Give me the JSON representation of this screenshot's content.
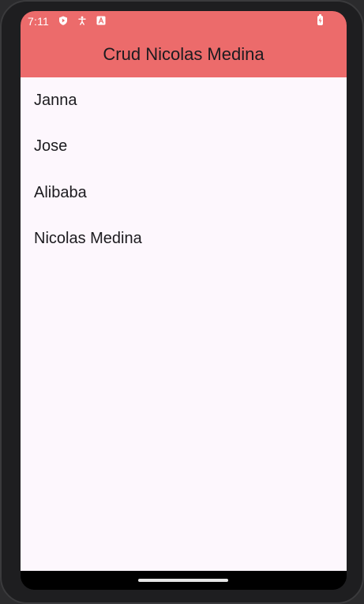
{
  "status_bar": {
    "time": "7:11",
    "icons": [
      "play-protect-icon",
      "accessibility-icon",
      "font-a-icon"
    ],
    "battery_icon": "battery-charging-icon"
  },
  "app_bar": {
    "title": "Crud Nicolas Medina"
  },
  "list": {
    "items": [
      {
        "label": "Janna"
      },
      {
        "label": "Jose"
      },
      {
        "label": "Alibaba"
      },
      {
        "label": "Nicolas Medina"
      }
    ]
  },
  "fab": {
    "icon": "add-icon"
  },
  "colors": {
    "app_bar": "#ec6b6b",
    "background": "#fdf7fd",
    "fab": "#eadff9",
    "text": "#1c1b1f"
  }
}
